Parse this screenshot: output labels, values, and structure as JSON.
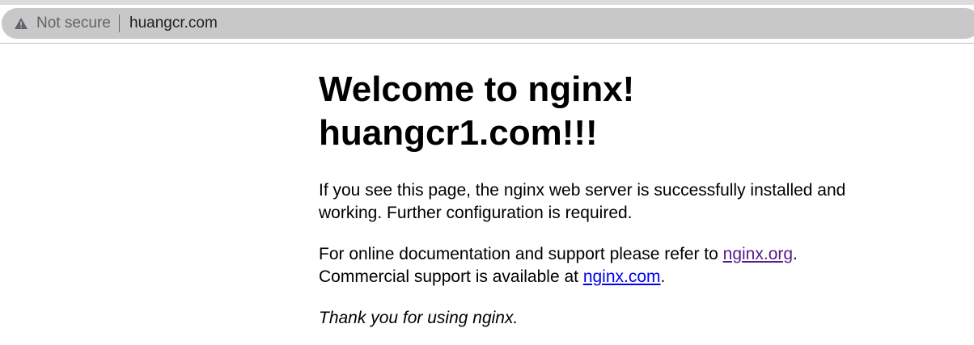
{
  "browser": {
    "security_label": "Not secure",
    "url": "huangcr.com",
    "icons": {
      "security": "warning-icon"
    }
  },
  "page": {
    "heading_line1": "Welcome to nginx!",
    "heading_line2": "huangcr1.com!!!",
    "para1": "If you see this page, the nginx web server is successfully installed and working. Further configuration is required.",
    "para2_prefix": "For online documentation and support please refer to ",
    "link1": "nginx.org",
    "para2_mid": ".",
    "para2_line2_prefix": "Commercial support is available at ",
    "link2": "nginx.com",
    "para2_suffix": ".",
    "thanks": "Thank you for using nginx."
  },
  "colors": {
    "visited_link": "#551a8b",
    "link": "#0000ee",
    "address_bar": "#c8c8c8"
  }
}
